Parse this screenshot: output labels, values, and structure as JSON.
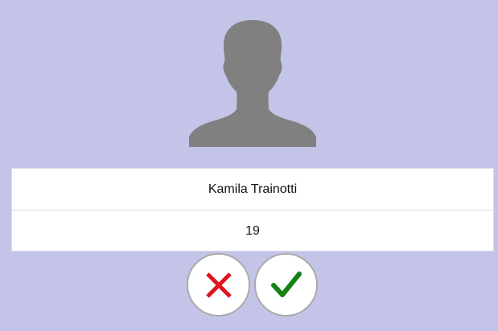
{
  "profile": {
    "name": "Kamila Trainotti",
    "age": "19"
  },
  "icons": {
    "avatar": "user-silhouette-icon",
    "reject": "close-x-icon",
    "accept": "checkmark-icon"
  },
  "colors": {
    "background": "#c4c4e8",
    "avatar": "#808080",
    "reject": "#e0141e",
    "accept": "#148214"
  }
}
